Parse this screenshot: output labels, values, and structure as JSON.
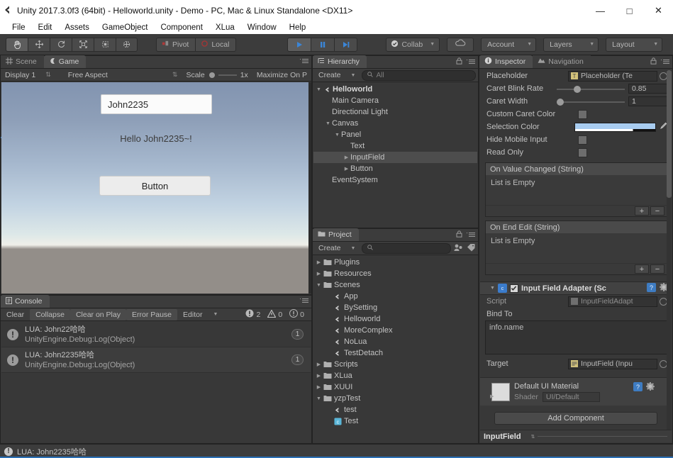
{
  "window": {
    "title": "Unity 2017.3.0f3 (64bit) - Helloworld.unity - Demo - PC, Mac & Linux Standalone <DX11>",
    "logo_icon": "unity-logo-icon",
    "minimize": "—",
    "maximize": "□",
    "close": "✕"
  },
  "menubar": {
    "items": [
      "File",
      "Edit",
      "Assets",
      "GameObject",
      "Component",
      "XLua",
      "Window",
      "Help"
    ]
  },
  "toolbar": {
    "transform_tools": [
      {
        "name": "hand-tool",
        "active": true
      },
      {
        "name": "move-tool",
        "active": false
      },
      {
        "name": "rotate-tool",
        "active": false
      },
      {
        "name": "scale-tool",
        "active": false
      },
      {
        "name": "rect-tool",
        "active": false
      },
      {
        "name": "transform-tool",
        "active": false
      }
    ],
    "pivot_label": "Pivot",
    "local_label": "Local",
    "play_label": "play-button",
    "pause_label": "pause-button",
    "step_label": "step-button",
    "collab_label": "Collab",
    "cloud_label": "cloud-icon",
    "account_label": "Account",
    "layers_label": "Layers",
    "layout_label": "Layout"
  },
  "game_panel": {
    "tabs": [
      {
        "label": "Scene",
        "icon": "grid-icon",
        "active": false
      },
      {
        "label": "Game",
        "icon": "game-icon",
        "active": true
      }
    ],
    "display": "Display 1",
    "aspect": "Free Aspect",
    "scale_label": "Scale",
    "scale_value": "1x",
    "maximize_label": "Maximize On P",
    "content": {
      "input_value": "John2235",
      "greeting": "Hello John2235~!",
      "button_label": "Button"
    }
  },
  "console_panel": {
    "tab_label": "Console",
    "tab_icon": "console-icon",
    "buttons": [
      "Clear",
      "Collapse",
      "Clear on Play",
      "Error Pause",
      "Editor"
    ],
    "counts": {
      "errors": "2",
      "warnings": "0",
      "logs": "0"
    },
    "entries": [
      {
        "line1": "LUA: John22哈哈",
        "line2": "UnityEngine.Debug:Log(Object)",
        "count": "1",
        "icon": "error-icon"
      },
      {
        "line1": "LUA: John2235哈哈",
        "line2": "UnityEngine.Debug:Log(Object)",
        "count": "1",
        "icon": "error-icon"
      }
    ]
  },
  "hierarchy_panel": {
    "tab_label": "Hierarchy",
    "tab_icon": "hierarchy-icon",
    "create_label": "Create",
    "search_placeholder": "All",
    "tree": [
      {
        "label": "Helloworld",
        "depth": 0,
        "arrow": "down",
        "icon": "unity-scene-icon",
        "selected": false,
        "root": true
      },
      {
        "label": "Main Camera",
        "depth": 1,
        "arrow": "",
        "icon": "",
        "selected": false,
        "root": false
      },
      {
        "label": "Directional Light",
        "depth": 1,
        "arrow": "",
        "icon": "",
        "selected": false,
        "root": false
      },
      {
        "label": "Canvas",
        "depth": 1,
        "arrow": "down",
        "icon": "",
        "selected": false,
        "root": false
      },
      {
        "label": "Panel",
        "depth": 2,
        "arrow": "down",
        "icon": "",
        "selected": false,
        "root": false
      },
      {
        "label": "Text",
        "depth": 3,
        "arrow": "",
        "icon": "",
        "selected": false,
        "root": false
      },
      {
        "label": "InputField",
        "depth": 3,
        "arrow": "right",
        "icon": "",
        "selected": true,
        "root": false
      },
      {
        "label": "Button",
        "depth": 3,
        "arrow": "right",
        "icon": "",
        "selected": false,
        "root": false
      },
      {
        "label": "EventSystem",
        "depth": 1,
        "arrow": "",
        "icon": "",
        "selected": false,
        "root": false
      }
    ]
  },
  "project_panel": {
    "tab_label": "Project",
    "tab_icon": "folder-icon",
    "create_label": "Create",
    "search_placeholder": "",
    "tree": [
      {
        "label": "Plugins",
        "depth": 0,
        "arrow": "right",
        "icon": "folder"
      },
      {
        "label": "Resources",
        "depth": 0,
        "arrow": "right",
        "icon": "folder"
      },
      {
        "label": "Scenes",
        "depth": 0,
        "arrow": "down",
        "icon": "folder"
      },
      {
        "label": "App",
        "depth": 1,
        "arrow": "",
        "icon": "unity-scene"
      },
      {
        "label": "BySetting",
        "depth": 1,
        "arrow": "",
        "icon": "unity-scene"
      },
      {
        "label": "Helloworld",
        "depth": 1,
        "arrow": "",
        "icon": "unity-scene"
      },
      {
        "label": "MoreComplex",
        "depth": 1,
        "arrow": "",
        "icon": "unity-scene"
      },
      {
        "label": "NoLua",
        "depth": 1,
        "arrow": "",
        "icon": "unity-scene"
      },
      {
        "label": "TestDetach",
        "depth": 1,
        "arrow": "",
        "icon": "unity-scene"
      },
      {
        "label": "Scripts",
        "depth": 0,
        "arrow": "right",
        "icon": "folder"
      },
      {
        "label": "XLua",
        "depth": 0,
        "arrow": "right",
        "icon": "folder"
      },
      {
        "label": "XUUI",
        "depth": 0,
        "arrow": "right",
        "icon": "folder"
      },
      {
        "label": "yzpTest",
        "depth": 0,
        "arrow": "down",
        "icon": "folder"
      },
      {
        "label": "test",
        "depth": 1,
        "arrow": "",
        "icon": "unity-scene"
      },
      {
        "label": "Test",
        "depth": 1,
        "arrow": "",
        "icon": "script"
      }
    ]
  },
  "inspector_panel": {
    "tabs": [
      {
        "label": "Inspector",
        "icon": "info-icon",
        "active": true
      },
      {
        "label": "Navigation",
        "icon": "navigation-icon",
        "active": false
      }
    ],
    "properties": [
      {
        "label": "Placeholder",
        "type": "object",
        "value": "Placeholder (Te"
      },
      {
        "label": "Caret Blink Rate",
        "type": "slider",
        "value": "0.85",
        "knob_pct": 27
      },
      {
        "label": "Caret Width",
        "type": "slider",
        "value": "1",
        "knob_pct": 4
      },
      {
        "label": "Custom Caret Color",
        "type": "checkbox",
        "value": false
      },
      {
        "label": "Selection Color",
        "type": "color",
        "value": "#a8ccf0"
      },
      {
        "label": "Hide Mobile Input",
        "type": "checkbox",
        "value": false
      },
      {
        "label": "Read Only",
        "type": "checkbox",
        "value": false
      }
    ],
    "events": [
      {
        "title": "On Value Changed (String)",
        "empty_text": "List is Empty",
        "add": "+",
        "remove": "−"
      },
      {
        "title": "On End Edit (String)",
        "empty_text": "List is Empty",
        "add": "+",
        "remove": "−"
      }
    ],
    "component": {
      "title": "Input Field Adapter (Sc",
      "enabled": true,
      "script_label": "Script",
      "script_value": "InputFieldAdapt",
      "bind_label": "Bind To",
      "bind_value": "info.name",
      "target_label": "Target",
      "target_value": "InputField (Inpu",
      "help_icon": "help-icon",
      "gear_icon": "gear-icon"
    },
    "material": {
      "name": "Default UI Material",
      "shader_label": "Shader",
      "shader_value": "UI/Default"
    },
    "add_component_label": "Add Component",
    "footer_name": "InputField"
  },
  "statusbar": {
    "message": "LUA: John2235哈哈",
    "icon": "error-icon"
  },
  "colors": {
    "accent_blue": "#2a6fb5",
    "panel_bg": "#383838",
    "selection_color": "#a8ccf0"
  }
}
